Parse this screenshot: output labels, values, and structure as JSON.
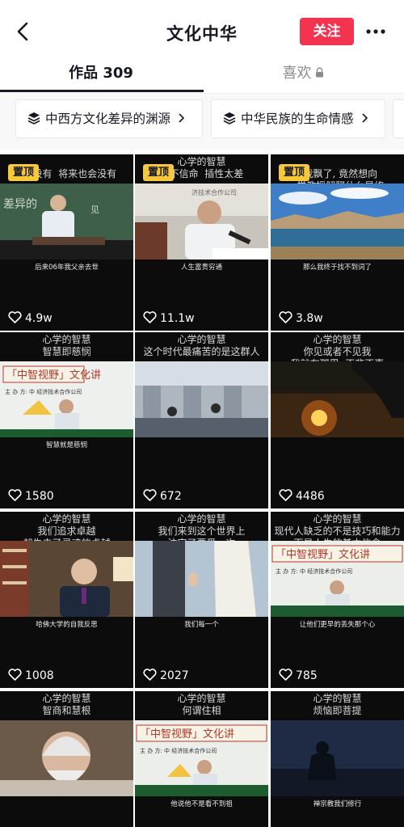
{
  "header": {
    "back_icon": "chevron-left-icon",
    "title": "文化中华",
    "follow_label": "关注",
    "more_icon": "more-dots-icon"
  },
  "tabs": {
    "works_label": "作品 309",
    "likes_label": "喜欢",
    "likes_lock_icon": "lock-icon"
  },
  "collections": [
    {
      "label": "中西方文化差异的渊源",
      "icon": "layers-icon"
    },
    {
      "label": "中华民族的生命情感",
      "icon": "layers-icon"
    }
  ],
  "pinned_label": "置顶",
  "videos": [
    {
      "top_text": "               \n  ​会没有  将来也会没有",
      "caption": "后来06年我父亲去世",
      "likes": "4.9w",
      "pinned": true,
      "scene": "lecture-chalkboard"
    },
    {
      "top_text": "心学的智慧\n上不信命  插性太差",
      "caption": "人生富贵穷通",
      "likes": "11.1w",
      "pinned": true,
      "scene": "lecture-microphone"
    },
    {
      "top_text": "\n  我飘了, 竟然想向\n  学教授解释什么是修",
      "caption": "那么我终于找不到词了",
      "likes": "3.8w",
      "pinned": true,
      "scene": "lake-landscape"
    },
    {
      "top_text": "心学的智慧\n智慧即慈悯",
      "caption": "智慧就是慈悯",
      "likes": "1580",
      "pinned": false,
      "scene": "lecture-fan"
    },
    {
      "top_text": "心学的智慧\n这个时代最痛苦的是这群人",
      "caption": "",
      "likes": "672",
      "pinned": false,
      "scene": "office-room"
    },
    {
      "top_text": "心学的智慧\n你见或者不见我\n我就在那里  不悲不喜",
      "caption": "",
      "likes": "4486",
      "pinned": false,
      "scene": "sunset"
    },
    {
      "top_text": "心学的智慧\n我们追求卓越\n却失去了灵魂的卓越",
      "caption": "哈佛大学的自我反思",
      "likes": "1008",
      "pinned": false,
      "scene": "professor-study"
    },
    {
      "top_text": "心学的智慧\n我们来到这个世界上\n注定了要爱一次",
      "caption": "我们每一个",
      "likes": "2027",
      "pinned": false,
      "scene": "two-people"
    },
    {
      "top_text": "心学的智慧\n现代人缺乏的不是技巧和能力\n而是人生的基本信念",
      "caption": "让他们更早的丢失那个心",
      "likes": "785",
      "pinned": false,
      "scene": "lecture-banner"
    },
    {
      "top_text": "心学的智慧\n智商和慧根",
      "caption": "",
      "likes": "",
      "pinned": false,
      "scene": "elder-portrait"
    },
    {
      "top_text": "心学的智慧\n何谓住相",
      "caption": "他说他不是看不到祖",
      "likes": "",
      "pinned": false,
      "scene": "lecture-fan-2"
    },
    {
      "top_text": "心学的智慧\n烦恼即菩提",
      "caption": "禅宗教我们修行",
      "likes": "",
      "pinned": false,
      "scene": "silhouette-dusk"
    }
  ],
  "scene_texts": {
    "banner": "「中智视野」文化讲坛",
    "banner_sub": "主 办 方:  中      经济技术合作公司"
  },
  "colors": {
    "follow_button": "#f3334f",
    "pinned_badge": "#f7c83a",
    "cell_background": "#0c0c0c"
  }
}
